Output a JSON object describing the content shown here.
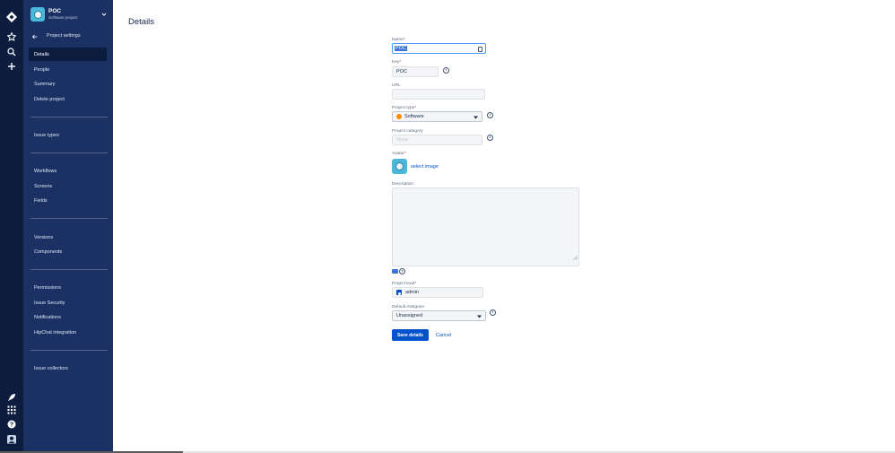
{
  "rail": {
    "icons": [
      "jira-logo-icon",
      "star-icon",
      "search-icon",
      "plus-icon",
      "rocket-icon",
      "apps-grid-icon",
      "help-icon",
      "user-profile-icon"
    ]
  },
  "sidebar": {
    "project_name": "POC",
    "project_type": "Software project",
    "back_label": "Project settings",
    "items": [
      {
        "label": "Details"
      },
      {
        "label": "People"
      },
      {
        "label": "Summary"
      },
      {
        "label": "Delete project"
      },
      {
        "label": "Issue types"
      },
      {
        "label": "Workflows"
      },
      {
        "label": "Screens"
      },
      {
        "label": "Fields"
      },
      {
        "label": "Versions"
      },
      {
        "label": "Components"
      },
      {
        "label": "Permissions"
      },
      {
        "label": "Issue Security"
      },
      {
        "label": "Notifications"
      },
      {
        "label": "HipChat integration"
      },
      {
        "label": "Issue collectors"
      }
    ],
    "active_item": "Details"
  },
  "main": {
    "title": "Details",
    "form": {
      "name_label": "Name",
      "name_value": "POC",
      "key_label": "Key",
      "key_value": "POC",
      "url_label": "URL",
      "url_value": "",
      "type_label": "Project type",
      "type_value": "Software",
      "category_label": "Project category",
      "category_value": "None",
      "avatar_label": "Avatar",
      "select_image": "select image",
      "description_label": "Description",
      "description_value": "",
      "lead_label": "Project lead",
      "lead_value": "admin",
      "assignee_label": "Default Assignee",
      "assignee_value": "Unassigned",
      "required_marker": "*",
      "info_glyph": "i",
      "help_glyph": "?",
      "save_label": "Save details",
      "cancel_label": "Cancel"
    }
  },
  "colors": {
    "rail_bg": "#0d1d3f",
    "sidebar_bg": "#1b3163",
    "primary": "#0052cc",
    "focus": "#4c9aff"
  }
}
